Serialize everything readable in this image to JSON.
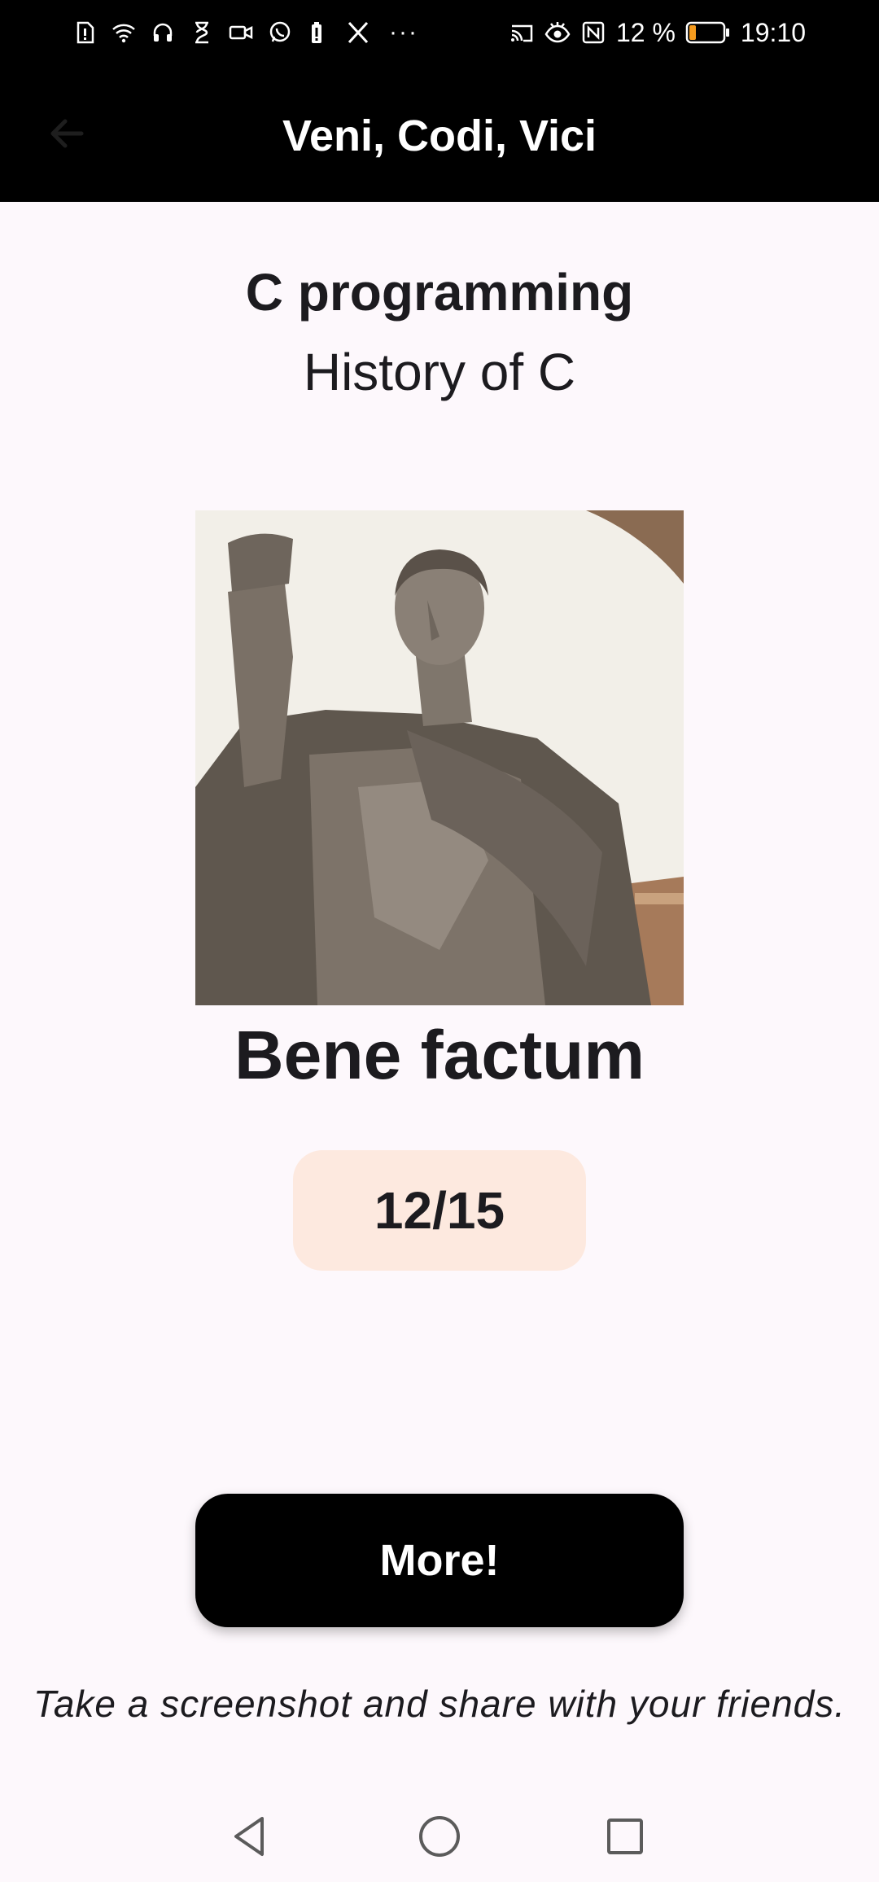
{
  "status_bar": {
    "icons": [
      "sim-alert-icon",
      "wifi-icon",
      "headset-icon",
      "hourglass-icon",
      "video-icon",
      "whatsapp-icon",
      "battery-alert-icon",
      "x-icon"
    ],
    "more": "···",
    "right_icons": [
      "cast-icon",
      "eye-icon",
      "nfc-icon"
    ],
    "battery_percent": "12 %",
    "battery_level": 0.12,
    "time": "19:10"
  },
  "app_bar": {
    "title": "Veni, Codi, Vici",
    "back_icon": "arrow-left-icon"
  },
  "content": {
    "course": "C programming",
    "lesson": "History of C",
    "image_subject": "statue",
    "result": "Bene factum",
    "score": "12/15",
    "more_button": "More!",
    "share_hint": "Take a screenshot and share with your friends."
  },
  "nav_bar": {
    "icons": [
      "back-triangle-icon",
      "home-circle-icon",
      "recents-square-icon"
    ]
  },
  "colors": {
    "background": "#fdf8fc",
    "bar": "#000000",
    "badge": "#fde9df",
    "text": "#1c1b1f",
    "battery_low": "#f59b1e"
  }
}
